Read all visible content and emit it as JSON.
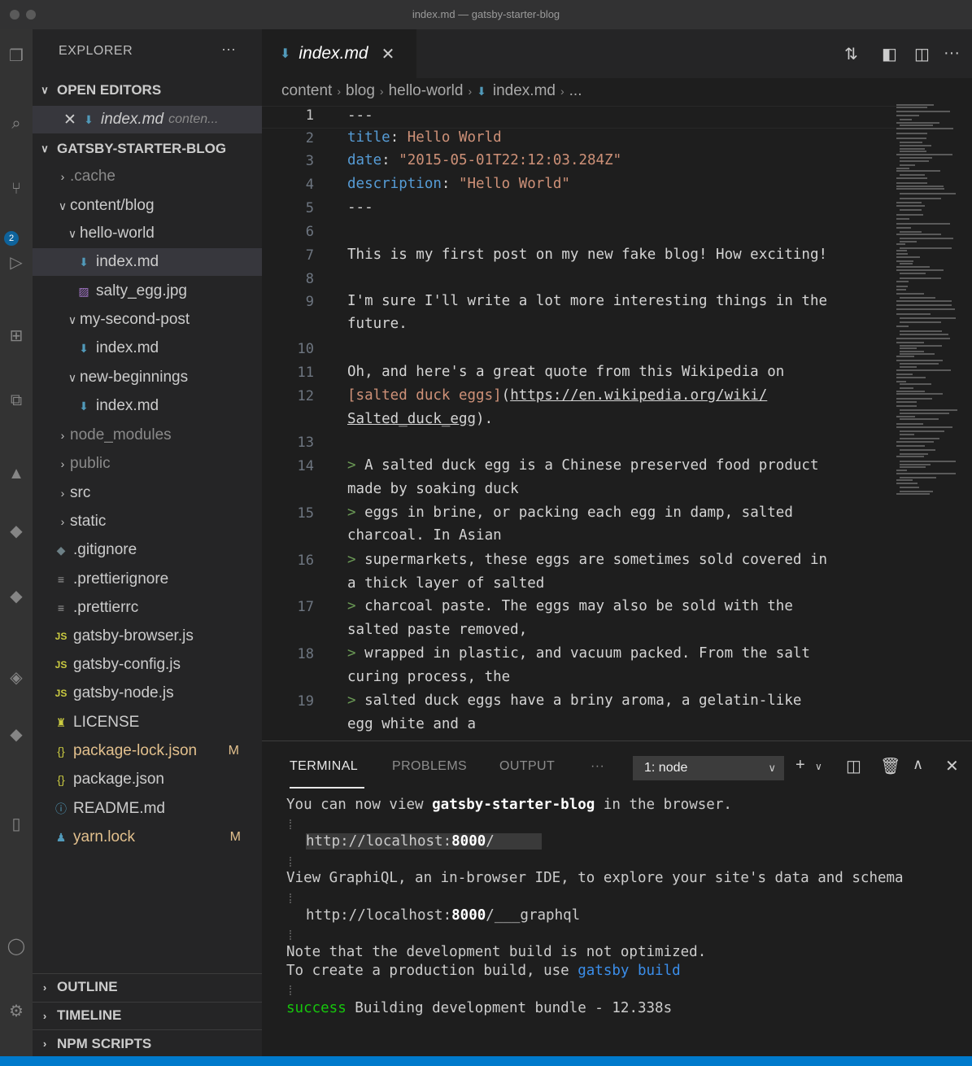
{
  "window": {
    "title": "index.md — gatsby-starter-blog"
  },
  "activity": {
    "badge": "2"
  },
  "sidebar": {
    "header": "EXPLORER",
    "more": "···",
    "open_editors": {
      "label": "OPEN EDITORS",
      "item_name": "index.md",
      "item_path": "conten..."
    },
    "project": {
      "label": "GATSBY-STARTER-BLOG",
      "items": [
        {
          "label": ".cache"
        },
        {
          "label": "content/blog"
        },
        {
          "label": "hello-world"
        },
        {
          "label": "index.md"
        },
        {
          "label": "salty_egg.jpg"
        },
        {
          "label": "my-second-post"
        },
        {
          "label": "index.md"
        },
        {
          "label": "new-beginnings"
        },
        {
          "label": "index.md"
        },
        {
          "label": "node_modules"
        },
        {
          "label": "public"
        },
        {
          "label": "src"
        },
        {
          "label": "static"
        },
        {
          "label": ".gitignore"
        },
        {
          "label": ".prettierignore"
        },
        {
          "label": ".prettierrc"
        },
        {
          "label": "gatsby-browser.js"
        },
        {
          "label": "gatsby-config.js"
        },
        {
          "label": "gatsby-node.js"
        },
        {
          "label": "LICENSE"
        },
        {
          "label": "package-lock.json",
          "badge": "M"
        },
        {
          "label": "package.json"
        },
        {
          "label": "README.md"
        },
        {
          "label": "yarn.lock",
          "badge": "M"
        }
      ]
    },
    "bottom_sections": [
      "OUTLINE",
      "TIMELINE",
      "NPM SCRIPTS"
    ]
  },
  "editor": {
    "tab_label": "index.md",
    "breadcrumb": [
      "content",
      "blog",
      "hello-world",
      "index.md",
      "..."
    ],
    "line_numbers": [
      "1",
      "2",
      "3",
      "4",
      "5",
      "6",
      "7",
      "8",
      "9",
      "10",
      "11",
      "12",
      "13",
      "14",
      "15",
      "16",
      "17",
      "18",
      "19"
    ],
    "front": {
      "dashes": "---",
      "title_key": "title",
      "title_val": "Hello World",
      "date_key": "date",
      "date_val": "\"2015-05-01T22:12:03.284Z\"",
      "desc_key": "description",
      "desc_val": "\"Hello World\""
    },
    "body": {
      "l7": "This is my first post on my new fake blog! How exciting!",
      "l9a": "I'm sure I'll write a lot more interesting things in the",
      "l9b": "future.",
      "l11": "Oh, and here's a great quote from this Wikipedia on",
      "l12_text": "[salted duck eggs]",
      "l12_open": "(",
      "l12_url": "https://en.wikipedia.org/wiki/",
      "l12_url2": "Salted_duck_egg",
      "l12_close": ").",
      "gt": ">",
      "q14a": " A salted duck egg is a Chinese preserved food product",
      "q14b": "made by soaking duck",
      "q15a": " eggs in brine, or packing each egg in damp, salted",
      "q15b": "charcoal. In Asian",
      "q16a": " supermarkets, these eggs are sometimes sold covered in",
      "q16b": "a thick layer of salted",
      "q17a": " charcoal paste. The eggs may also be sold with the",
      "q17b": "salted paste removed,",
      "q18a": " wrapped in plastic, and vacuum packed. From the salt",
      "q18b": "curing process, the",
      "q19a": " salted duck eggs have a briny aroma, a gelatin-like",
      "q19b": "egg white and a"
    }
  },
  "panel": {
    "tabs": [
      "TERMINAL",
      "PROBLEMS",
      "OUTPUT",
      "···"
    ],
    "dropdown": "1: node",
    "lines": {
      "view_pre": "You can now view ",
      "view_bold": "gatsby-starter-blog",
      "view_post": " in the browser.",
      "url1": "http://localhost:8000/",
      "url1_pre": "http://localhost:",
      "url1_port": "8000",
      "url1_post": "/",
      "graphiql": "View GraphiQL, an in-browser IDE, to explore your site's data and schema",
      "url2_pre": "http://localhost:",
      "url2_port": "8000",
      "url2_post": "/___graphql",
      "note": "Note that the development build is not optimized.",
      "prod_pre": "To create a production build, use ",
      "prod_cmd": "gatsby build",
      "success": "success",
      "building": " Building development bundle - 12.338s"
    }
  }
}
